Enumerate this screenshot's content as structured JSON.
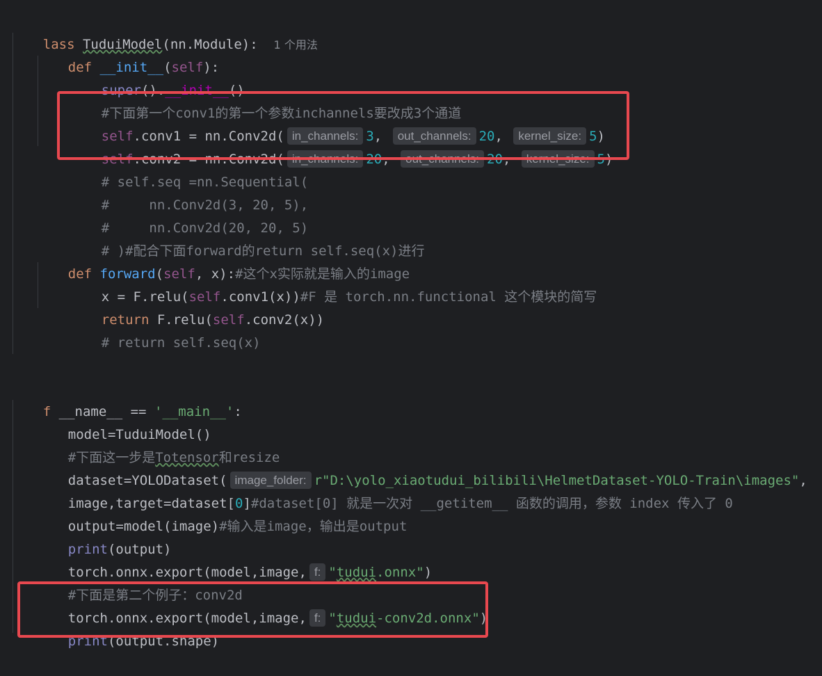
{
  "code": {
    "l1_kw": "lass",
    "l1_name": "TuduiModel",
    "l1_rest": "(nn.Module):",
    "l1_usage": "1 个用法",
    "l2_kw": "def",
    "l2_fn": "__init__",
    "l2_p1": "(",
    "l2_self": "self",
    "l2_p2": "):",
    "l3_super": "super",
    "l3_mid": "().",
    "l3_init": "__init__",
    "l3_end": "()",
    "l4_comment": "#下面第一个conv1的第一个参数inchannels要改成3个通道",
    "l5_self": "self",
    "l5_a": ".conv1 = nn.Conv2d(",
    "l5_h1": "in_channels:",
    "l5_v1": "3",
    "l5_c1": ", ",
    "l5_h2": "out_channels:",
    "l5_v2": "20",
    "l5_c2": ", ",
    "l5_h3": "kernel_size:",
    "l5_v3": "5",
    "l5_end": ")",
    "l6_self": "self",
    "l6_a": ".conv2 = nn.Conv2d(",
    "l6_h1": "in_channels:",
    "l6_v1": "20",
    "l6_c1": ", ",
    "l6_h2": "out_channels:",
    "l6_v2": "20",
    "l6_c2": ", ",
    "l6_h3": "kernel_size:",
    "l6_v3": "5",
    "l6_end": ")",
    "l7": "# self.seq =nn.Sequential(",
    "l8": "#     nn.Conv2d(3, 20, 5),",
    "l9": "#     nn.Conv2d(20, 20, 5)",
    "l10": "# )#配合下面forward的return self.seq(x)进行",
    "l11_kw": "def",
    "l11_fn": "forward",
    "l11_p1": "(",
    "l11_self": "self",
    "l11_p2": ", x):",
    "l11_comment": "#这个x实际就是输入的image",
    "l12_a": "x = F.relu(",
    "l12_self": "self",
    "l12_b": ".conv1(x))",
    "l12_comment": "#F 是 torch.nn.functional 这个模块的简写",
    "l13_kw": "return",
    "l13_a": " F.relu(",
    "l13_self": "self",
    "l13_b": ".conv2(x))",
    "l14": "# return self.seq(x)",
    "l15_kw": "f",
    "l15_a": " __name__ == ",
    "l15_str": "'__main__'",
    "l15_end": ":",
    "l16": "model=TuduiModel()",
    "l17_a": "#下面这一步是",
    "l17_b": "Totensor",
    "l17_c": "和resize",
    "l18_a": "dataset=YOLODataset(",
    "l18_hint": "image_folder:",
    "l18_str": "r\"D:\\yolo_xiaotudui_bilibili\\HelmetDataset-YOLO-Train\\images\"",
    "l18_end": ",",
    "l19_a": "image,target=dataset[",
    "l19_num": "0",
    "l19_b": "]",
    "l19_comment": "#dataset[0] 就是一次对 __getitem__ 函数的调用，参数 index 传入了 0",
    "l20_a": "output=model(image)",
    "l20_comment": "#输入是image，输出是output",
    "l21_print": "print",
    "l21_rest": "(output)",
    "l22_a": "torch.onnx.export(model,image,",
    "l22_hint": "f:",
    "l22_q1": "\"",
    "l22_str": "tudui",
    "l22_str2": ".onnx\"",
    "l22_end": ")",
    "l23": "#下面是第二个例子：conv2d",
    "l24_a": "torch.onnx.export(model,image,",
    "l24_hint": "f:",
    "l24_q1": "\"",
    "l24_str": "tudui",
    "l24_str2": "-conv2d.onnx\"",
    "l24_end": ")",
    "l25_print": "print",
    "l25_rest": "(output.shape)"
  },
  "colors": {
    "background": "#1e1f22",
    "keyword": "#cf8e6d",
    "self": "#94558d",
    "function": "#56a8f5",
    "number": "#2aacb8",
    "string": "#6aab73",
    "comment": "#7a7e85",
    "highlight_box": "#e8484f"
  }
}
